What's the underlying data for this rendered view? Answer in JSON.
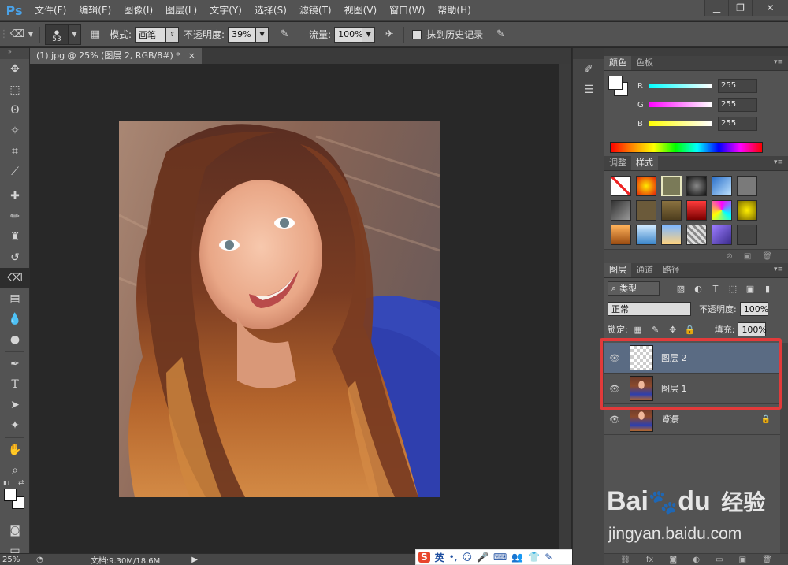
{
  "app": {
    "logo": "Ps"
  },
  "menu": [
    "文件(F)",
    "编辑(E)",
    "图像(I)",
    "图层(L)",
    "文字(Y)",
    "选择(S)",
    "滤镜(T)",
    "视图(V)",
    "窗口(W)",
    "帮助(H)"
  ],
  "options": {
    "brush_size": "53",
    "mode_label": "模式:",
    "mode_value": "画笔",
    "opacity_label": "不透明度:",
    "opacity_value": "39%",
    "flow_label": "流量:",
    "flow_value": "100%",
    "history_label": "抹到历史记录"
  },
  "document": {
    "tab_title": "(1).jpg @ 25% (图层 2, RGB/8#) *",
    "close": "×"
  },
  "status": {
    "zoom": "25%",
    "doc_info": "文档:9.30M/18.6M"
  },
  "color_panel": {
    "tabs": [
      "颜色",
      "色板"
    ],
    "r_label": "R",
    "g_label": "G",
    "b_label": "B",
    "r_value": "255",
    "g_value": "255",
    "b_value": "255"
  },
  "styles_panel": {
    "tabs": [
      "调整",
      "样式"
    ]
  },
  "layers_panel": {
    "tabs": [
      "图层",
      "通道",
      "路径"
    ],
    "filter_kind": "类型",
    "blend_mode": "正常",
    "opacity_label": "不透明度:",
    "opacity_value": "100%",
    "lock_label": "锁定:",
    "fill_label": "填充:",
    "fill_value": "100%",
    "layers": [
      {
        "name": "图层 2"
      },
      {
        "name": "图层 1"
      },
      {
        "name": "背景"
      }
    ]
  },
  "ime": {
    "lang": "英"
  },
  "watermark": {
    "brand_a": "Bai",
    "brand_b": "du",
    "brand_cn": "经验",
    "url": "jingyan.baidu.com"
  },
  "colors": {
    "highlight": "#e23a3a",
    "selected_layer": "#5a6b83",
    "ps_blue": "#4aa2e8"
  }
}
